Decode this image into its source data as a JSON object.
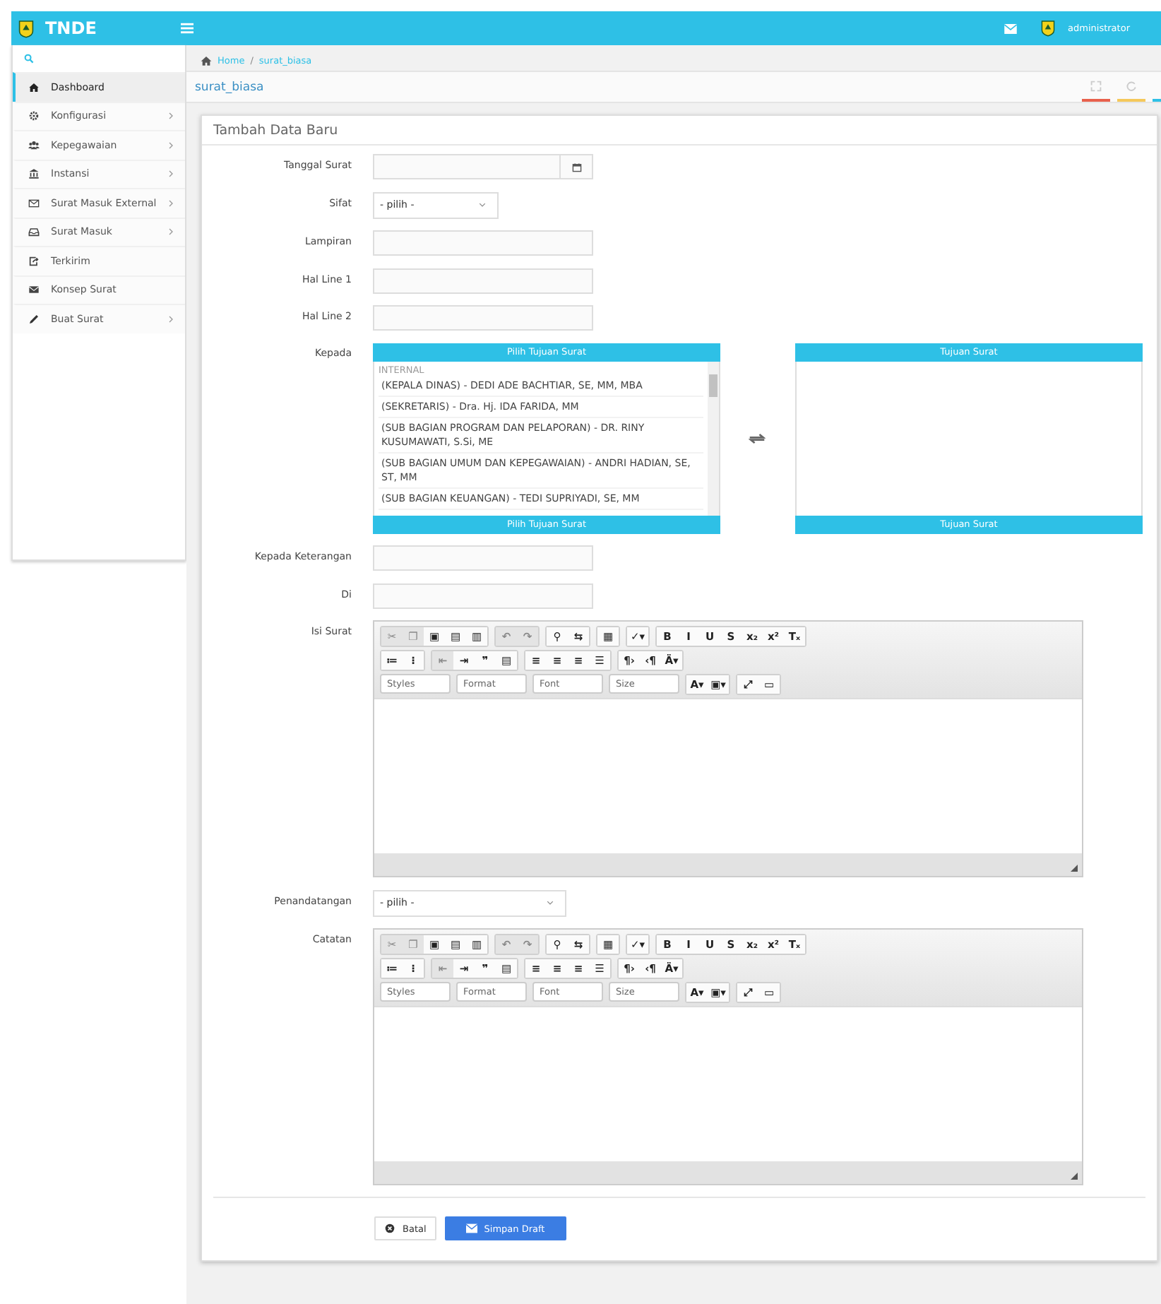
{
  "header": {
    "app_name": "TNDE",
    "user": "administrator"
  },
  "sidebar": {
    "items": [
      {
        "label": "Dashboard",
        "selected": true,
        "has_submenu": false
      },
      {
        "label": "Konfigurasi",
        "selected": false,
        "has_submenu": true
      },
      {
        "label": "Kepegawaian",
        "selected": false,
        "has_submenu": true
      },
      {
        "label": "Instansi",
        "selected": false,
        "has_submenu": true
      },
      {
        "label": "Surat Masuk External",
        "selected": false,
        "has_submenu": true
      },
      {
        "label": "Surat Masuk",
        "selected": false,
        "has_submenu": true
      },
      {
        "label": "Terkirim",
        "selected": false,
        "has_submenu": false
      },
      {
        "label": "Konsep Surat",
        "selected": false,
        "has_submenu": false
      },
      {
        "label": "Buat Surat",
        "selected": false,
        "has_submenu": true
      }
    ]
  },
  "breadcrumb": {
    "items": [
      "Home",
      "surat_biasa"
    ],
    "separator": "/"
  },
  "page_title": "surat_biasa",
  "card": {
    "title": "Tambah Data Baru",
    "fields": [
      {
        "kind": "date",
        "label": "Tanggal Surat"
      },
      {
        "kind": "select",
        "label": "Sifat",
        "value": "- pilih -"
      },
      {
        "kind": "text",
        "label": "Lampiran"
      },
      {
        "kind": "text",
        "label": "Hal Line 1"
      },
      {
        "kind": "text",
        "label": "Hal Line 2"
      },
      {
        "kind": "recipients",
        "label": "Kepada",
        "source": {
          "header": "Pilih Tujuan Surat",
          "footer": "Pilih Tujuan Surat",
          "group": "INTERNAL",
          "options": [
            "(KEPALA DINAS) - DEDI ADE BACHTIAR, SE, MM, MBA",
            "(SEKRETARIS) - Dra. Hj. IDA FARIDA, MM",
            "(SUB BAGIAN PROGRAM DAN PELAPORAN) - DR. RINY KUSUMAWATI, S.Si, ME",
            "(SUB BAGIAN UMUM DAN KEPEGAWAIAN) - ANDRI HADIAN, SE, ST, MM",
            "(SUB BAGIAN KEUANGAN) - TEDI SUPRIYADI, SE, MM"
          ]
        },
        "target": {
          "header": "Tujuan Surat",
          "footer": "Tujuan Surat"
        }
      },
      {
        "kind": "text",
        "label": "Kepada Keterangan"
      },
      {
        "kind": "text",
        "label": "Di"
      },
      {
        "kind": "editor",
        "label": "Isi Surat",
        "toolbar": [
          [
            [
              {
                "kind": "button",
                "glyph": "✂",
                "disabled": true
              },
              {
                "kind": "button",
                "glyph": "❐",
                "disabled": true
              },
              {
                "kind": "button",
                "glyph": "▣",
                "disabled": false
              },
              {
                "kind": "button",
                "glyph": "▤",
                "disabled": false
              },
              {
                "kind": "button",
                "glyph": "▥",
                "disabled": false
              }
            ],
            [
              {
                "kind": "button",
                "glyph": "↶",
                "disabled": true
              },
              {
                "kind": "button",
                "glyph": "↷",
                "disabled": true
              }
            ],
            [
              {
                "kind": "button",
                "glyph": "⚲",
                "disabled": false
              },
              {
                "kind": "button",
                "glyph": "⇆",
                "disabled": false
              }
            ],
            [
              {
                "kind": "button",
                "glyph": "▦",
                "disabled": false
              }
            ],
            [
              {
                "kind": "button",
                "glyph": "✓▾",
                "disabled": false
              }
            ],
            [
              {
                "kind": "button",
                "glyph": "B",
                "disabled": false
              },
              {
                "kind": "button",
                "glyph": "I",
                "disabled": false
              },
              {
                "kind": "button",
                "glyph": "U",
                "disabled": false
              },
              {
                "kind": "button",
                "glyph": "S",
                "disabled": false
              },
              {
                "kind": "button",
                "glyph": "x₂",
                "disabled": false
              },
              {
                "kind": "button",
                "glyph": "x²",
                "disabled": false
              },
              {
                "kind": "button",
                "glyph": "Tₓ",
                "disabled": false
              }
            ]
          ],
          [
            [
              {
                "kind": "button",
                "glyph": "≔",
                "disabled": false
              },
              {
                "kind": "button",
                "glyph": "⁝",
                "disabled": false
              }
            ],
            [
              {
                "kind": "button",
                "glyph": "⇤",
                "disabled": true
              },
              {
                "kind": "button",
                "glyph": "⇥",
                "disabled": false
              },
              {
                "kind": "button",
                "glyph": "❞",
                "disabled": false
              },
              {
                "kind": "button",
                "glyph": "▤",
                "disabled": false
              }
            ],
            [
              {
                "kind": "button",
                "glyph": "≡",
                "disabled": false
              },
              {
                "kind": "button",
                "glyph": "≡",
                "disabled": false
              },
              {
                "kind": "button",
                "glyph": "≡",
                "disabled": false
              },
              {
                "kind": "button",
                "glyph": "☰",
                "disabled": false
              }
            ],
            [
              {
                "kind": "button",
                "glyph": "¶›",
                "disabled": false
              },
              {
                "kind": "button",
                "glyph": "‹¶",
                "disabled": false
              },
              {
                "kind": "button",
                "glyph": "Ä▾",
                "disabled": false
              }
            ]
          ],
          [
            [
              {
                "kind": "combo",
                "glyph": "Styles",
                "disabled": false
              }
            ],
            [
              {
                "kind": "combo",
                "glyph": "Format",
                "disabled": false
              }
            ],
            [
              {
                "kind": "combo",
                "glyph": "Font",
                "disabled": false
              }
            ],
            [
              {
                "kind": "combo",
                "glyph": "Size",
                "disabled": false
              }
            ],
            [
              {
                "kind": "button",
                "glyph": "A▾",
                "disabled": false
              },
              {
                "kind": "button",
                "glyph": "▣▾",
                "disabled": false
              }
            ],
            [
              {
                "kind": "button",
                "glyph": "⤢",
                "disabled": false
              },
              {
                "kind": "button",
                "glyph": "▭",
                "disabled": false
              }
            ]
          ]
        ]
      },
      {
        "kind": "select",
        "label": "Penandatangan",
        "value": "- pilih -"
      },
      {
        "kind": "editor",
        "label": "Catatan",
        "toolbar": [
          [
            [
              {
                "kind": "button",
                "glyph": "✂",
                "disabled": true
              },
              {
                "kind": "button",
                "glyph": "❐",
                "disabled": true
              },
              {
                "kind": "button",
                "glyph": "▣",
                "disabled": false
              },
              {
                "kind": "button",
                "glyph": "▤",
                "disabled": false
              },
              {
                "kind": "button",
                "glyph": "▥",
                "disabled": false
              }
            ],
            [
              {
                "kind": "button",
                "glyph": "↶",
                "disabled": true
              },
              {
                "kind": "button",
                "glyph": "↷",
                "disabled": true
              }
            ],
            [
              {
                "kind": "button",
                "glyph": "⚲",
                "disabled": false
              },
              {
                "kind": "button",
                "glyph": "⇆",
                "disabled": false
              }
            ],
            [
              {
                "kind": "button",
                "glyph": "▦",
                "disabled": false
              }
            ],
            [
              {
                "kind": "button",
                "glyph": "✓▾",
                "disabled": false
              }
            ],
            [
              {
                "kind": "button",
                "glyph": "B",
                "disabled": false
              },
              {
                "kind": "button",
                "glyph": "I",
                "disabled": false
              },
              {
                "kind": "button",
                "glyph": "U",
                "disabled": false
              },
              {
                "kind": "button",
                "glyph": "S",
                "disabled": false
              },
              {
                "kind": "button",
                "glyph": "x₂",
                "disabled": false
              },
              {
                "kind": "button",
                "glyph": "x²",
                "disabled": false
              },
              {
                "kind": "button",
                "glyph": "Tₓ",
                "disabled": false
              }
            ]
          ],
          [
            [
              {
                "kind": "button",
                "glyph": "≔",
                "disabled": false
              },
              {
                "kind": "button",
                "glyph": "⁝",
                "disabled": false
              }
            ],
            [
              {
                "kind": "button",
                "glyph": "⇤",
                "disabled": true
              },
              {
                "kind": "button",
                "glyph": "⇥",
                "disabled": false
              },
              {
                "kind": "button",
                "glyph": "❞",
                "disabled": false
              },
              {
                "kind": "button",
                "glyph": "▤",
                "disabled": false
              }
            ],
            [
              {
                "kind": "button",
                "glyph": "≡",
                "disabled": false
              },
              {
                "kind": "button",
                "glyph": "≡",
                "disabled": false
              },
              {
                "kind": "button",
                "glyph": "≡",
                "disabled": false
              },
              {
                "kind": "button",
                "glyph": "☰",
                "disabled": false
              }
            ],
            [
              {
                "kind": "button",
                "glyph": "¶›",
                "disabled": false
              },
              {
                "kind": "button",
                "glyph": "‹¶",
                "disabled": false
              },
              {
                "kind": "button",
                "glyph": "Ä▾",
                "disabled": false
              }
            ]
          ],
          [
            [
              {
                "kind": "combo",
                "glyph": "Styles",
                "disabled": false
              }
            ],
            [
              {
                "kind": "combo",
                "glyph": "Format",
                "disabled": false
              }
            ],
            [
              {
                "kind": "combo",
                "glyph": "Font",
                "disabled": false
              }
            ],
            [
              {
                "kind": "combo",
                "glyph": "Size",
                "disabled": false
              }
            ],
            [
              {
                "kind": "button",
                "glyph": "A▾",
                "disabled": false
              },
              {
                "kind": "button",
                "glyph": "▣▾",
                "disabled": false
              }
            ],
            [
              {
                "kind": "button",
                "glyph": "⤢",
                "disabled": false
              },
              {
                "kind": "button",
                "glyph": "▭",
                "disabled": false
              }
            ]
          ]
        ]
      }
    ],
    "buttons": [
      {
        "kind": "cancel",
        "label": "Batal"
      },
      {
        "kind": "primary",
        "label": "Simpan Draft"
      }
    ]
  }
}
